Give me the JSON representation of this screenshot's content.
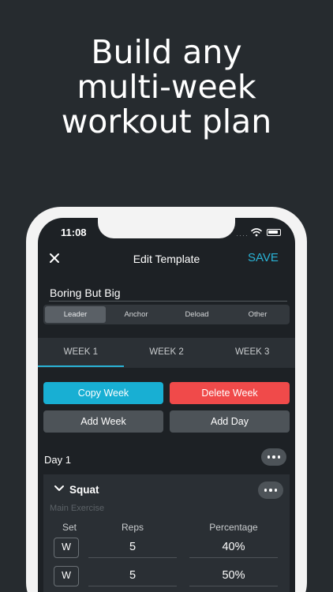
{
  "headline": {
    "line1": "Build any",
    "line2": "multi-week",
    "line3": "workout plan"
  },
  "status": {
    "time": "11:08",
    "signal_dots": "····"
  },
  "nav": {
    "title": "Edit Template",
    "save_label": "SAVE"
  },
  "template": {
    "name": "Boring But Big"
  },
  "segments": [
    {
      "label": "Leader"
    },
    {
      "label": "Anchor"
    },
    {
      "label": "Deload"
    },
    {
      "label": "Other"
    }
  ],
  "weeks": [
    {
      "label": "WEEK 1"
    },
    {
      "label": "WEEK 2"
    },
    {
      "label": "WEEK 3"
    }
  ],
  "actions": {
    "copy_week": "Copy Week",
    "delete_week": "Delete Week",
    "add_week": "Add Week",
    "add_day": "Add Day"
  },
  "day": {
    "label": "Day 1"
  },
  "exercise": {
    "name": "Squat",
    "subtitle": "Main Exercise",
    "columns": {
      "set": "Set",
      "reps": "Reps",
      "percentage": "Percentage"
    },
    "rows": [
      {
        "set": "W",
        "reps": "5",
        "percentage": "40%"
      },
      {
        "set": "W",
        "reps": "5",
        "percentage": "50%"
      }
    ]
  },
  "colors": {
    "accent": "#18afd3",
    "danger": "#f04a4a",
    "background": "#262b2f",
    "screen": "#1d2125"
  }
}
